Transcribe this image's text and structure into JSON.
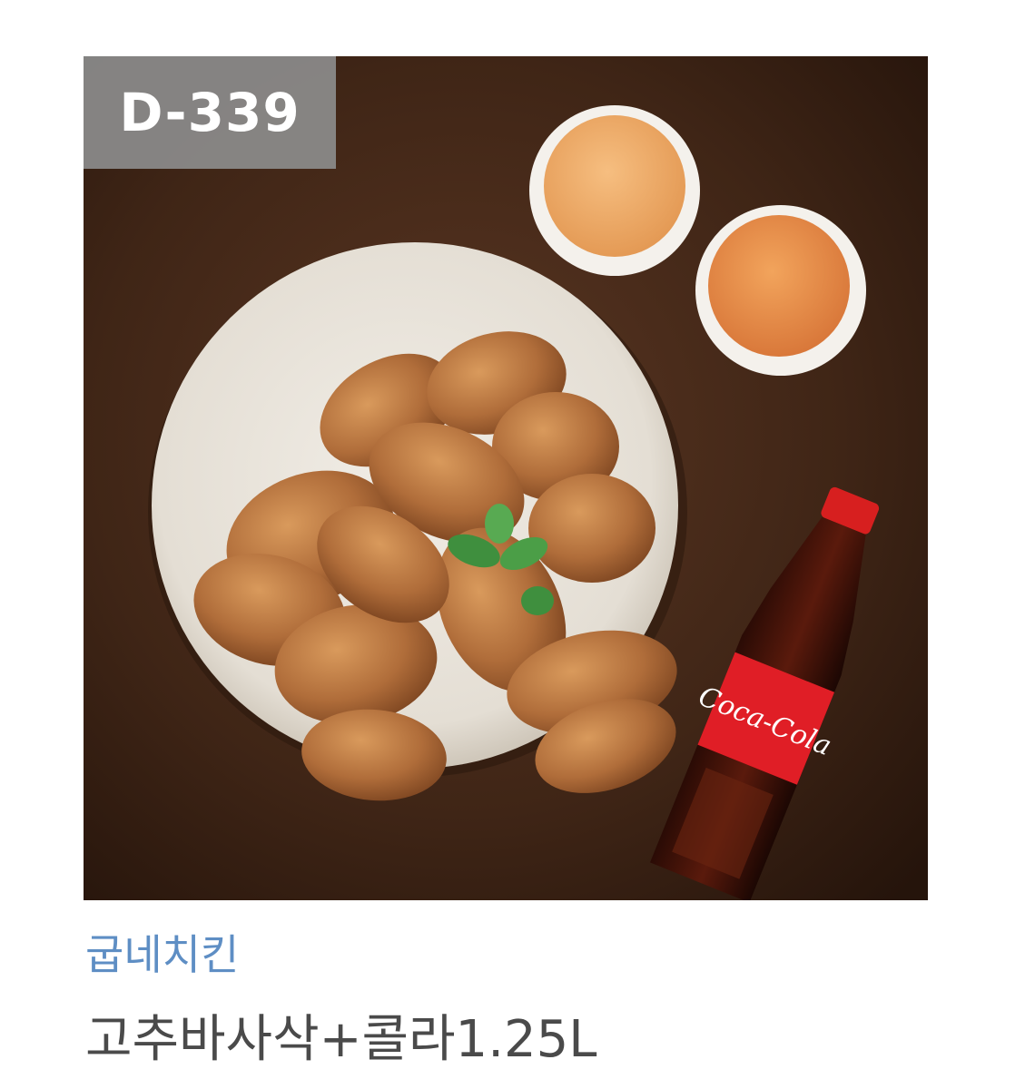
{
  "badge": {
    "dday": "D-339"
  },
  "product": {
    "brand": "굽네치킨",
    "name": "고추바사삭+콜라1.25L",
    "image_alt": "굽네치킨 고추바사삭+콜라1.25L",
    "bottle_label": "Coca-Cola"
  },
  "colors": {
    "brand_text": "#5e8ec4",
    "product_text": "#4a4a4a",
    "badge_bg": "#8c8c8c",
    "image_bg": "#3d2416"
  }
}
